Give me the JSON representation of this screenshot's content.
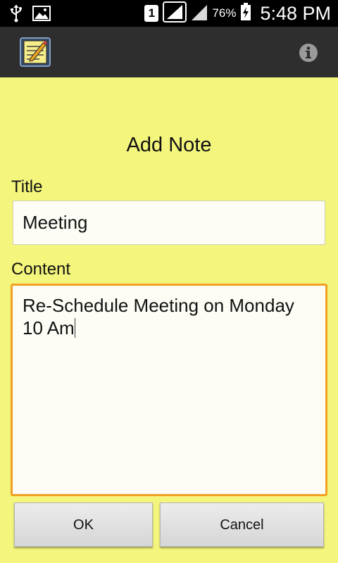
{
  "status_bar": {
    "sim_slot": "1",
    "battery_percent": "76%",
    "time": "5:48 PM",
    "icons": [
      "usb-icon",
      "image-icon",
      "signal-icon",
      "signal-icon",
      "battery-charging-icon"
    ]
  },
  "action_bar": {
    "app_icon": "notepad-icon",
    "info_icon": "info-icon"
  },
  "form": {
    "heading": "Add Note",
    "title_label": "Title",
    "title_value": "Meeting",
    "content_label": "Content",
    "content_value": "Re-Schedule Meeting on Monday\n10 Am"
  },
  "buttons": {
    "ok": "OK",
    "cancel": "Cancel"
  },
  "colors": {
    "background": "#f3f57c",
    "action_bar": "#2e2e2e",
    "focus_border": "#f0a022"
  }
}
